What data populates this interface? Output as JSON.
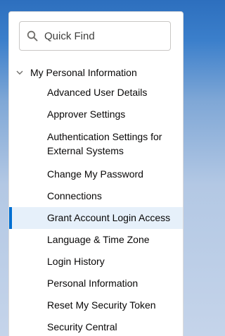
{
  "search": {
    "placeholder": "Quick Find",
    "icon": "search-icon"
  },
  "section": {
    "label": "My Personal Information",
    "expanded": true,
    "icon": "chevron-down-icon"
  },
  "items": [
    {
      "label": "Advanced User Details"
    },
    {
      "label": "Approver Settings"
    },
    {
      "label": "Authentication Settings for External Systems"
    },
    {
      "label": "Change My Password"
    },
    {
      "label": "Connections"
    },
    {
      "label": "Grant Account Login Access"
    },
    {
      "label": "Language & Time Zone"
    },
    {
      "label": "Login History"
    },
    {
      "label": "Personal Information"
    },
    {
      "label": "Reset My Security Token"
    },
    {
      "label": "Security Central"
    }
  ],
  "selected_item": "Grant Account Login Access",
  "colors": {
    "accent": "#0070d2",
    "selected_bg": "#e6f0fa",
    "text": "#080707"
  }
}
